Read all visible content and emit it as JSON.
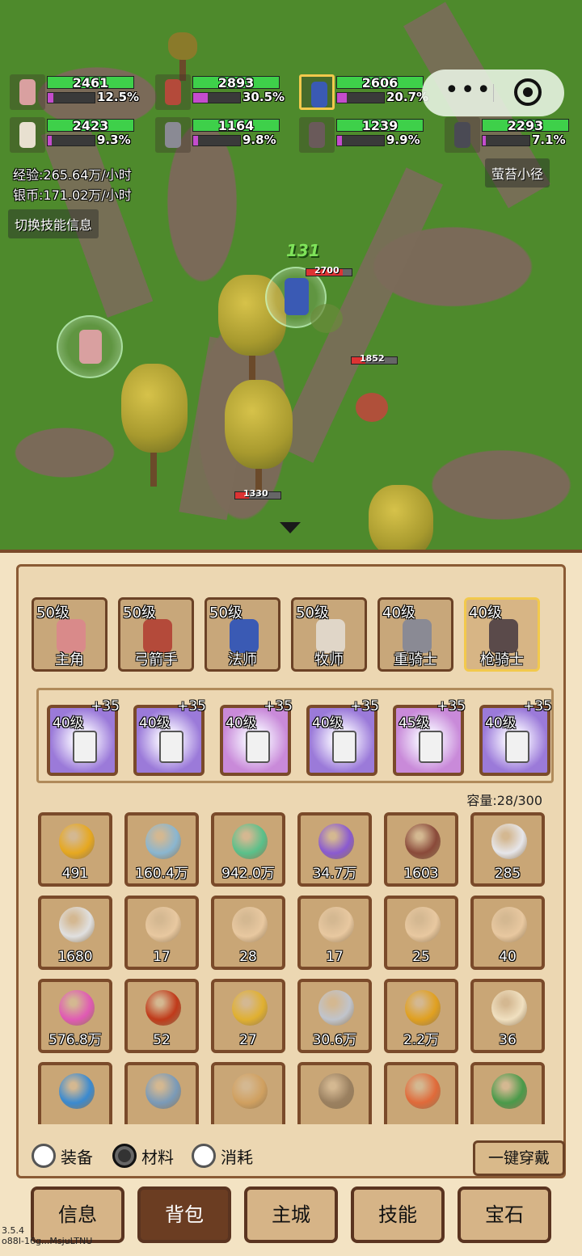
{
  "party": [
    {
      "hp": "2461",
      "xp_pct": "12.5%",
      "xp_fraction": 0.125,
      "hp_fraction": 1.0,
      "color": "#d9a0a0",
      "selected": false
    },
    {
      "hp": "2893",
      "xp_pct": "30.5%",
      "xp_fraction": 0.305,
      "hp_fraction": 1.0,
      "color": "#b44a3a",
      "selected": false
    },
    {
      "hp": "2606",
      "xp_pct": "20.7%",
      "xp_fraction": 0.207,
      "hp_fraction": 1.0,
      "color": "#3a5ab4",
      "selected": true
    },
    {
      "hp": "2423",
      "xp_pct": "9.3%",
      "xp_fraction": 0.093,
      "hp_fraction": 1.0,
      "color": "#e8e0d0",
      "selected": false
    },
    {
      "hp": "1164",
      "xp_pct": "9.8%",
      "xp_fraction": 0.098,
      "hp_fraction": 1.0,
      "color": "#8a8a94",
      "selected": false
    },
    {
      "hp": "1239",
      "xp_pct": "9.9%",
      "xp_fraction": 0.099,
      "hp_fraction": 1.0,
      "color": "#6a5a5a",
      "selected": false
    },
    {
      "hp": "2293",
      "xp_pct": "7.1%",
      "xp_fraction": 0.071,
      "hp_fraction": 1.0,
      "color": "#4a4a54",
      "selected": false
    }
  ],
  "rates": {
    "exp": "经验:265.64万/小时",
    "silver": "银币:171.02万/小时"
  },
  "map": {
    "location": "萤苔小径",
    "toggle_skill": "切换技能信息",
    "damage_text": "131",
    "mobs": [
      {
        "hp": "2700",
        "hp_fraction": 0.8
      },
      {
        "hp": "1852",
        "hp_fraction": 0.3
      },
      {
        "hp": "1330",
        "hp_fraction": 0.3
      }
    ]
  },
  "heroes": [
    {
      "level": "50级",
      "name": "主角",
      "color": "#d98a8a",
      "selected": false
    },
    {
      "level": "50级",
      "name": "弓箭手",
      "color": "#b44a3a",
      "selected": false
    },
    {
      "level": "50级",
      "name": "法师",
      "color": "#3a5ab4",
      "selected": false
    },
    {
      "level": "50级",
      "name": "牧师",
      "color": "#e0d6c8",
      "selected": false
    },
    {
      "level": "40级",
      "name": "重骑士",
      "color": "#8a8a94",
      "selected": false
    },
    {
      "level": "40级",
      "name": "枪骑士",
      "color": "#5a4a4a",
      "selected": true
    }
  ],
  "equipment": [
    {
      "level": "40级",
      "plus": "+35",
      "icon": "sword-icon",
      "bg": "#9b7ad9"
    },
    {
      "level": "40级",
      "plus": "+35",
      "icon": "helmet-icon",
      "bg": "#9b7ad9"
    },
    {
      "level": "40级",
      "plus": "+35",
      "icon": "armor-icon",
      "bg": "#c98ad9"
    },
    {
      "level": "40级",
      "plus": "+35",
      "icon": "leg-armor-icon",
      "bg": "#9b7ad9"
    },
    {
      "level": "45级",
      "plus": "+35",
      "icon": "cape-icon",
      "bg": "#c98ad9"
    },
    {
      "level": "40级",
      "plus": "+35",
      "icon": "boots-icon",
      "bg": "#9b7ad9"
    }
  ],
  "capacity": "容量:28/300",
  "inventory": [
    {
      "count": "491",
      "icon": "gold-coin-icon",
      "color": "#e6a820"
    },
    {
      "count": "160.4万",
      "icon": "blue-gem-icon",
      "color": "#8ab6d0"
    },
    {
      "count": "942.0万",
      "icon": "green-orb-icon",
      "color": "#5ac08a"
    },
    {
      "count": "34.7万",
      "icon": "purple-crystal-icon",
      "color": "#8a5ad0"
    },
    {
      "count": "1603",
      "icon": "wood-log-icon",
      "color": "#8a4a3a"
    },
    {
      "count": "285",
      "icon": "fang-icon",
      "color": "#e6e6ea"
    },
    {
      "count": "1680",
      "icon": "feather-icon",
      "color": "#e0e0e0"
    },
    {
      "count": "17",
      "icon": "scroll-icon",
      "color": "#e8c8a0"
    },
    {
      "count": "28",
      "icon": "scroll-icon",
      "color": "#e8c8a0"
    },
    {
      "count": "17",
      "icon": "scroll-icon",
      "color": "#e8c8a0"
    },
    {
      "count": "25",
      "icon": "scroll-icon",
      "color": "#e8c8a0"
    },
    {
      "count": "40",
      "icon": "scroll-icon",
      "color": "#e8c8a0"
    },
    {
      "count": "576.8万",
      "icon": "pink-gem-icon",
      "color": "#e05ab4"
    },
    {
      "count": "52",
      "icon": "fire-orb-icon",
      "color": "#c03a1a"
    },
    {
      "count": "27",
      "icon": "key-icon",
      "color": "#e0b030"
    },
    {
      "count": "30.6万",
      "icon": "silver-ore-icon",
      "color": "#c0c4cc"
    },
    {
      "count": "2.2万",
      "icon": "gold-ore-icon",
      "color": "#e0a020"
    },
    {
      "count": "36",
      "icon": "paper-scroll-icon",
      "color": "#f0e0c0"
    },
    {
      "count": "",
      "icon": "blue-core-icon",
      "color": "#3a8ad0"
    },
    {
      "count": "",
      "icon": "fish-icon",
      "color": "#7a9ab8"
    },
    {
      "count": "",
      "icon": "pufferfish-icon",
      "color": "#d0a060"
    },
    {
      "count": "",
      "icon": "eel-icon",
      "color": "#9a8060"
    },
    {
      "count": "",
      "icon": "starfish-icon",
      "color": "#e06a3a"
    },
    {
      "count": "",
      "icon": "turtle-icon",
      "color": "#4a9a4a"
    }
  ],
  "filters": [
    {
      "label": "装备",
      "checked": false
    },
    {
      "label": "材料",
      "checked": true
    },
    {
      "label": "消耗",
      "checked": false
    }
  ],
  "equip_all_label": "一键穿戴",
  "nav": [
    {
      "label": "信息",
      "active": false
    },
    {
      "label": "背包",
      "active": true
    },
    {
      "label": "主城",
      "active": false
    },
    {
      "label": "技能",
      "active": false
    },
    {
      "label": "宝石",
      "active": false
    }
  ],
  "version": [
    "3.5.4",
    "o88I-16g...MsjuLTNU"
  ]
}
